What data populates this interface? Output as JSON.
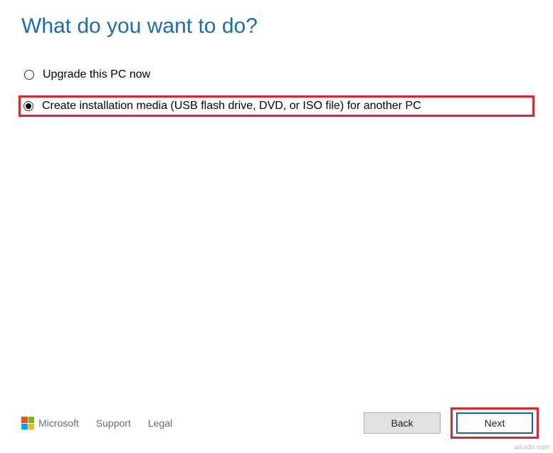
{
  "title": "What do you want to do?",
  "options": [
    {
      "label": "Upgrade this PC now",
      "selected": false,
      "highlighted": false
    },
    {
      "label": "Create installation media (USB flash drive, DVD, or ISO file) for another PC",
      "selected": true,
      "highlighted": true
    }
  ],
  "footer": {
    "brand": "Microsoft",
    "support": "Support",
    "legal": "Legal"
  },
  "buttons": {
    "back": "Back",
    "next": "Next"
  },
  "watermark": "wsxdn.com"
}
